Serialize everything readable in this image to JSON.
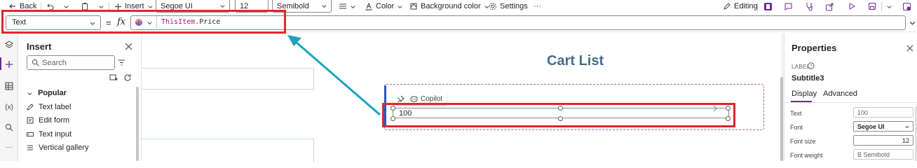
{
  "toolbar": {
    "back_label": "Back",
    "insert_label": "Insert",
    "font_value": "Segoe UI",
    "font_size_value": "12",
    "font_weight_value": "Semibold",
    "color_label": "Color",
    "background_color_label": "Background color",
    "settings_label": "Settings",
    "more_label": "···",
    "editing_label": "Editing"
  },
  "formula_bar": {
    "property_value": "Text",
    "fx_label": "fx",
    "equals": "=",
    "formula_keyword": "ThisItem",
    "formula_rest": ".Price"
  },
  "left_rail": {
    "variables_label": "{x}",
    "more_label": "···"
  },
  "insert_pane": {
    "title": "Insert",
    "search_placeholder": "Search",
    "section_label": "Popular",
    "items": [
      {
        "label": "Text label",
        "icon": "text-label-icon"
      },
      {
        "label": "Edit form",
        "icon": "edit-form-icon"
      },
      {
        "label": "Text input",
        "icon": "text-input-icon"
      },
      {
        "label": "Vertical gallery",
        "icon": "vertical-gallery-icon"
      }
    ]
  },
  "canvas": {
    "title": "Cart List",
    "copilot_label": "Copilot",
    "label_value": "100"
  },
  "properties": {
    "title": "Properties",
    "label_caption": "LABEL",
    "control_name": "Subtitle3",
    "tabs": [
      "Display",
      "Advanced"
    ],
    "rows": [
      {
        "label": "Text",
        "value": "100"
      },
      {
        "label": "Font",
        "value": "Segoe UI"
      },
      {
        "label": "Font size",
        "value": "12"
      },
      {
        "label": "Font weight",
        "value": "B  Semibold"
      }
    ]
  },
  "colors": {
    "accent": "#6b2c91",
    "highlight_red": "#e1262b",
    "arrow_teal": "#1aa3c0",
    "title_blue": "#4a6b8c"
  }
}
